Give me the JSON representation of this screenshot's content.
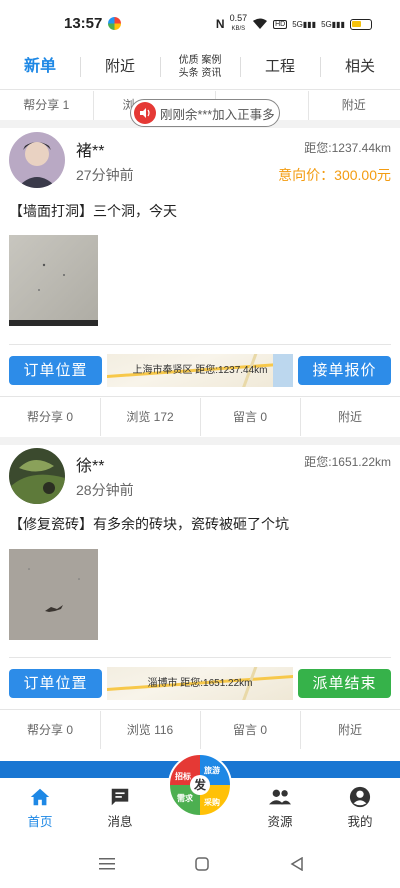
{
  "status": {
    "time": "13:57",
    "net_speed": "0.57",
    "net_unit": "KB/S",
    "hd": "HD",
    "sig1": "5G",
    "sig2": "5G"
  },
  "tabs": [
    {
      "label": "新单"
    },
    {
      "label": "附近"
    },
    {
      "label_line1": "优质 案例",
      "label_line2": "头条 资讯"
    },
    {
      "label": "工程"
    },
    {
      "label": "相关"
    }
  ],
  "toast": {
    "text": "刚刚余***加入正事多"
  },
  "prev_stats": {
    "share": "帮分享 1",
    "view": "浏",
    "nearby": "附近"
  },
  "cards": [
    {
      "name": "褚**",
      "time": "27分钟前",
      "distance": "距您:1237.44km",
      "price": "意向价：300.00元",
      "description": "【墙面打洞】三个洞，今天",
      "btn_left": "订单位置",
      "map_text": "上海市奉贤区   距您:1237.44km",
      "btn_right": "接单报价",
      "stats": {
        "share": "帮分享  0",
        "view": "浏览  172",
        "comment": "留言  0",
        "nearby": "附近"
      }
    },
    {
      "name": "徐**",
      "time": "28分钟前",
      "distance": "距您:1651.22km",
      "description": "【修复瓷砖】有多余的砖块，瓷砖被砸了个坑",
      "btn_left": "订单位置",
      "map_text": "淄博市   距您:1651.22km",
      "btn_right": "派单结束",
      "stats": {
        "share": "帮分享  0",
        "view": "浏览  116",
        "comment": "留言  0",
        "nearby": "附近"
      }
    }
  ],
  "fab": {
    "center": "发",
    "q1": "旅游",
    "q2": "招标",
    "q3": "采购",
    "q4": "需求"
  },
  "nav": [
    {
      "label": "首页",
      "icon": "home-icon"
    },
    {
      "label": "消息",
      "icon": "message-icon"
    },
    {
      "label": "资源",
      "icon": "people-icon"
    },
    {
      "label": "我的",
      "icon": "person-icon"
    }
  ],
  "colors": {
    "accent": "#1e88e5",
    "price": "#f39c12",
    "green": "#36b24a",
    "blue_btn": "#2d8ce8"
  }
}
